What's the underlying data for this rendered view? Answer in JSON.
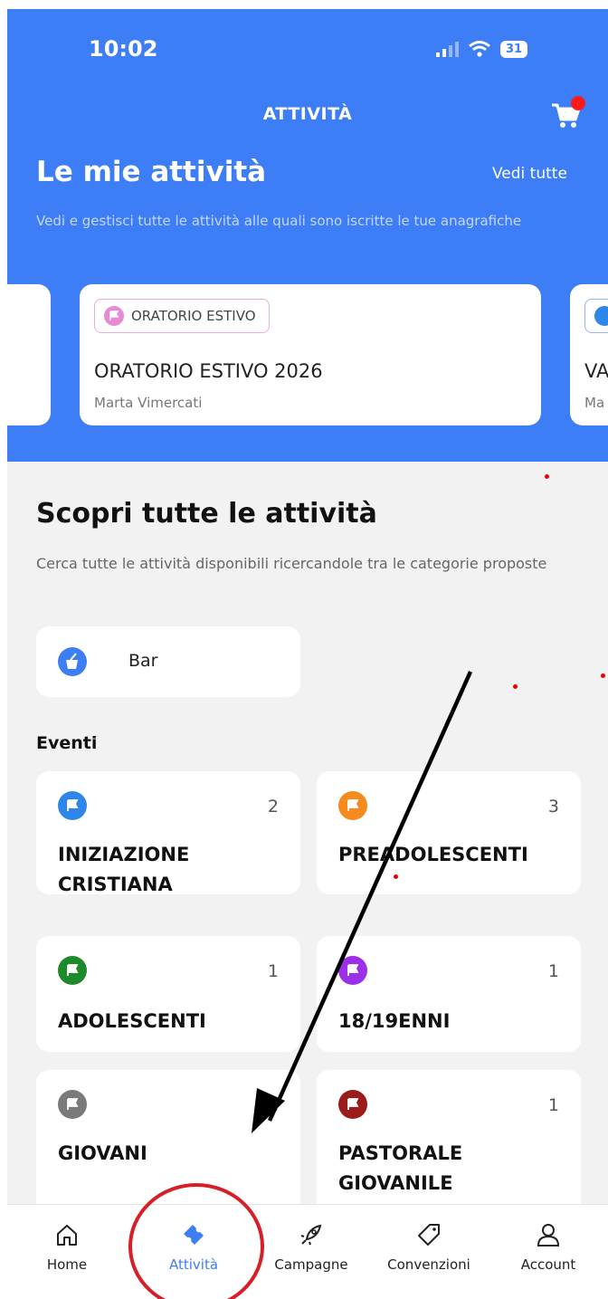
{
  "status": {
    "time": "10:02",
    "battery": "31"
  },
  "nav": {
    "title": "ATTIVITÀ"
  },
  "header": {
    "title": "Le mie attività",
    "see_all": "Vedi tutte",
    "subtitle": "Vedi e gestisci tutte le attività alle quali sono iscritte le tue anagrafiche"
  },
  "my_activities": [
    {
      "tag": "ORATORIO ESTIVO",
      "title": "ORATORIO ESTIVO 2026",
      "owner": "Marta Vimercati"
    },
    {
      "tag": "",
      "title": "VA",
      "owner": "Ma"
    }
  ],
  "discover": {
    "title": "Scopri tutte le attività",
    "subtitle": "Cerca tutte le attività disponibili ricercandole tra le categorie proposte",
    "bar_label": "Bar"
  },
  "events": {
    "heading": "Eventi",
    "items": [
      {
        "label": "INIZIAZIONE CRISTIANA",
        "count": "2",
        "color": "#2f86ea"
      },
      {
        "label": "PREADOLESCENTI",
        "count": "3",
        "color": "#f58a1f"
      },
      {
        "label": "ADOLESCENTI",
        "count": "1",
        "color": "#1f8a2c"
      },
      {
        "label": "18/19ENNI",
        "count": "1",
        "color": "#9b30e8"
      },
      {
        "label": "GIOVANI",
        "count": "1",
        "color": "#7a7a7a"
      },
      {
        "label": "PASTORALE GIOVANILE",
        "count": "1",
        "color": "#9c1b1b"
      }
    ]
  },
  "tabbar": [
    {
      "label": "Home",
      "icon": "home-icon"
    },
    {
      "label": "Attività",
      "icon": "ticket-icon",
      "active": true
    },
    {
      "label": "Campagne",
      "icon": "rocket-icon"
    },
    {
      "label": "Convenzioni",
      "icon": "tag-icon"
    },
    {
      "label": "Account",
      "icon": "user-icon"
    }
  ],
  "colors": {
    "primary": "#3d7df5",
    "active_tab": "#3d7df5",
    "annotation": "#d61f26"
  }
}
